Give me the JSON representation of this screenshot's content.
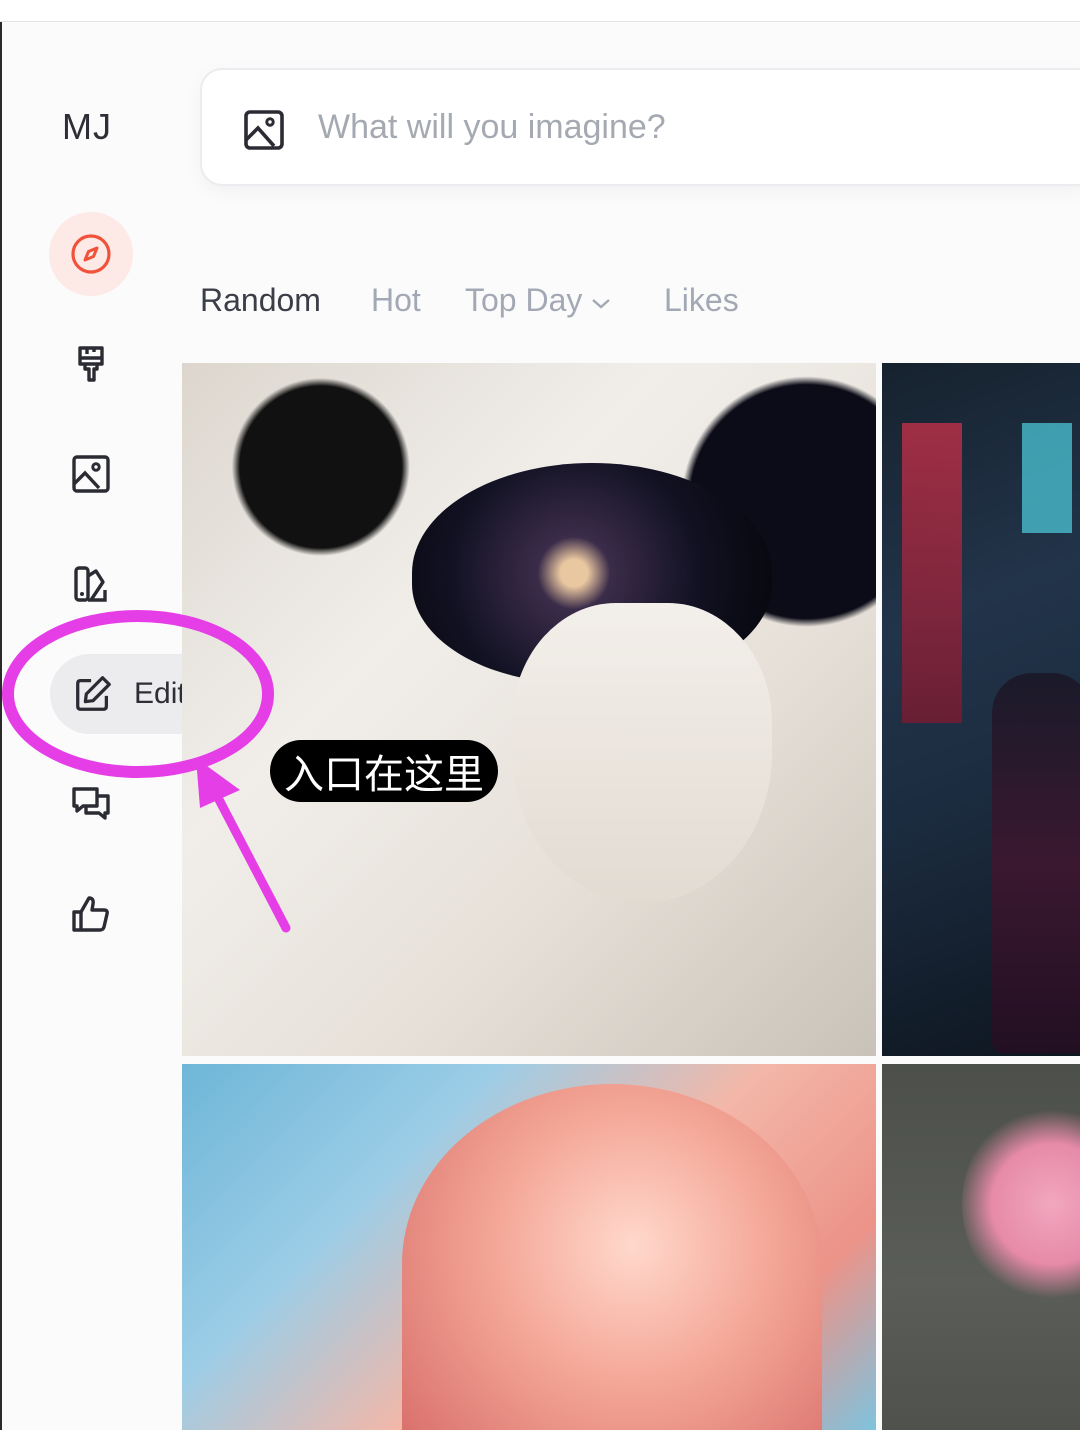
{
  "app": {
    "brand": "MJ"
  },
  "search": {
    "placeholder": "What will you imagine?",
    "icon": "image-icon"
  },
  "sidebar": {
    "items": [
      {
        "id": "explore",
        "icon": "compass-icon",
        "active": true
      },
      {
        "id": "create",
        "icon": "paintbrush-icon"
      },
      {
        "id": "organize",
        "icon": "image-icon"
      },
      {
        "id": "personalize",
        "icon": "swatch-icon"
      },
      {
        "id": "edit",
        "icon": "edit-icon",
        "label": "Edit",
        "hovered": true
      },
      {
        "id": "chat",
        "icon": "chat-icon"
      },
      {
        "id": "likes",
        "icon": "thumbs-up-icon"
      }
    ]
  },
  "tabs": [
    {
      "label": "Random",
      "active": true
    },
    {
      "label": "Hot"
    },
    {
      "label": "Top Day",
      "dropdown": true
    },
    {
      "label": "Likes"
    }
  ],
  "gallery": {
    "tiles": [
      {
        "subject": "white astronaut helmet with galaxy visor"
      },
      {
        "subject": "neon cyberpunk street figure"
      },
      {
        "subject": "face under water with pink petals"
      },
      {
        "subject": "pink feathered creature on gray"
      }
    ]
  },
  "annotation": {
    "callout_text": "入口在这里",
    "color": "#e63ee6"
  },
  "colors": {
    "accent": "#f0523a",
    "active_bg": "#fde9e6",
    "tab_inactive": "#a3a8b5"
  }
}
